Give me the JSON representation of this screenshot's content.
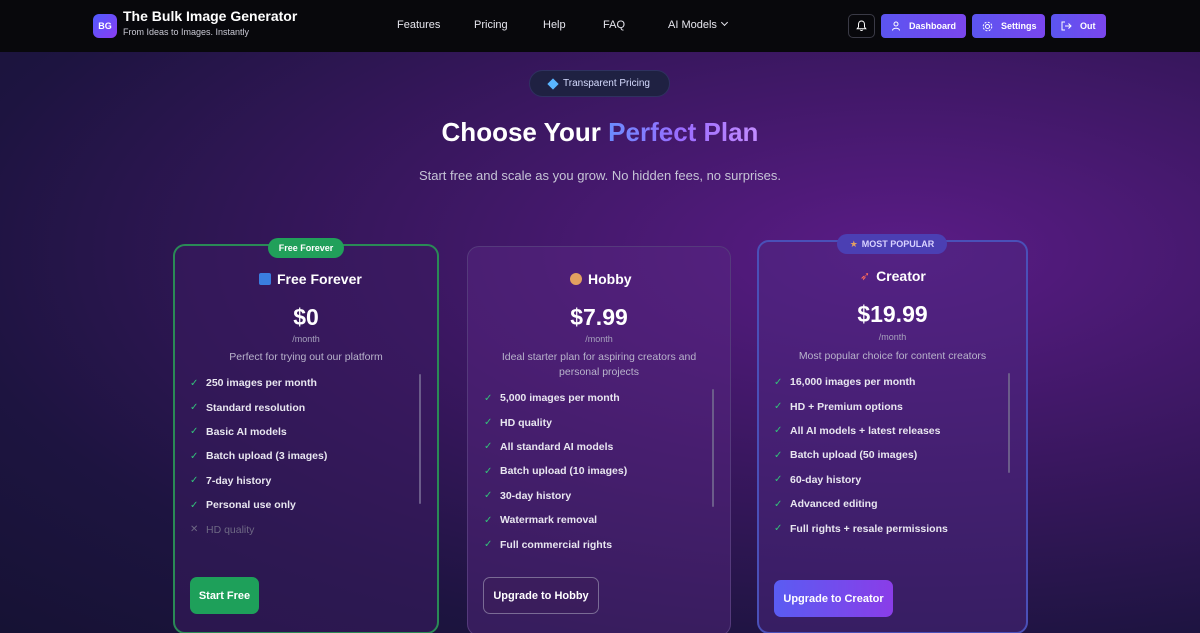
{
  "brand": {
    "logo_text": "BG",
    "title": "The Bulk Image Generator",
    "subtitle": "From Ideas to Images. Instantly"
  },
  "nav": {
    "links": [
      "Features",
      "Pricing",
      "Help",
      "FAQ",
      "AI Models"
    ]
  },
  "actions": {
    "dashboard": "Dashboard",
    "settings": "Settings",
    "out": "Out"
  },
  "hero": {
    "badge": "Transparent Pricing",
    "title_plain": "Choose Your ",
    "title_accent": "Perfect Plan",
    "subtitle": "Start free and scale as you grow. No hidden fees, no surprises."
  },
  "plans": [
    {
      "ribbon": "Free Forever",
      "name": "Free Forever",
      "price": "$0",
      "period": "/month",
      "description": "Perfect for trying out our platform",
      "features": [
        "250 images per month",
        "Standard resolution",
        "Basic AI models",
        "Batch upload (3 images)",
        "7-day history",
        "Personal use only"
      ],
      "excluded": [
        "HD quality"
      ],
      "cta": "Start Free",
      "icon": "free-badge-icon"
    },
    {
      "name": "Hobby",
      "price": "$7.99",
      "period": "/month",
      "description_lines": [
        "Ideal starter plan for aspiring creators and",
        "personal projects"
      ],
      "features": [
        "5,000 images per month",
        "HD quality",
        "All standard AI models",
        "Batch upload (10 images)",
        "30-day history",
        "Watermark removal",
        "Full commercial rights"
      ],
      "cta": "Upgrade to Hobby",
      "icon": "palette-icon"
    },
    {
      "ribbon": "MOST POPULAR",
      "name": "Creator",
      "price": "$19.99",
      "period": "/month",
      "description": "Most popular choice for content creators",
      "features": [
        "16,000 images per month",
        "HD + Premium options",
        "All AI models + latest releases",
        "Batch upload (50 images)",
        "60-day history",
        "Advanced editing",
        "Full rights + resale permissions"
      ],
      "cta": "Upgrade to Creator",
      "icon": "rocket-icon"
    }
  ],
  "colors": {
    "free_accent": "#21a05a",
    "popular_accent": "#4b3fb3",
    "primary_gradient_start": "#5b55f0",
    "primary_gradient_end": "#7a46ee"
  }
}
